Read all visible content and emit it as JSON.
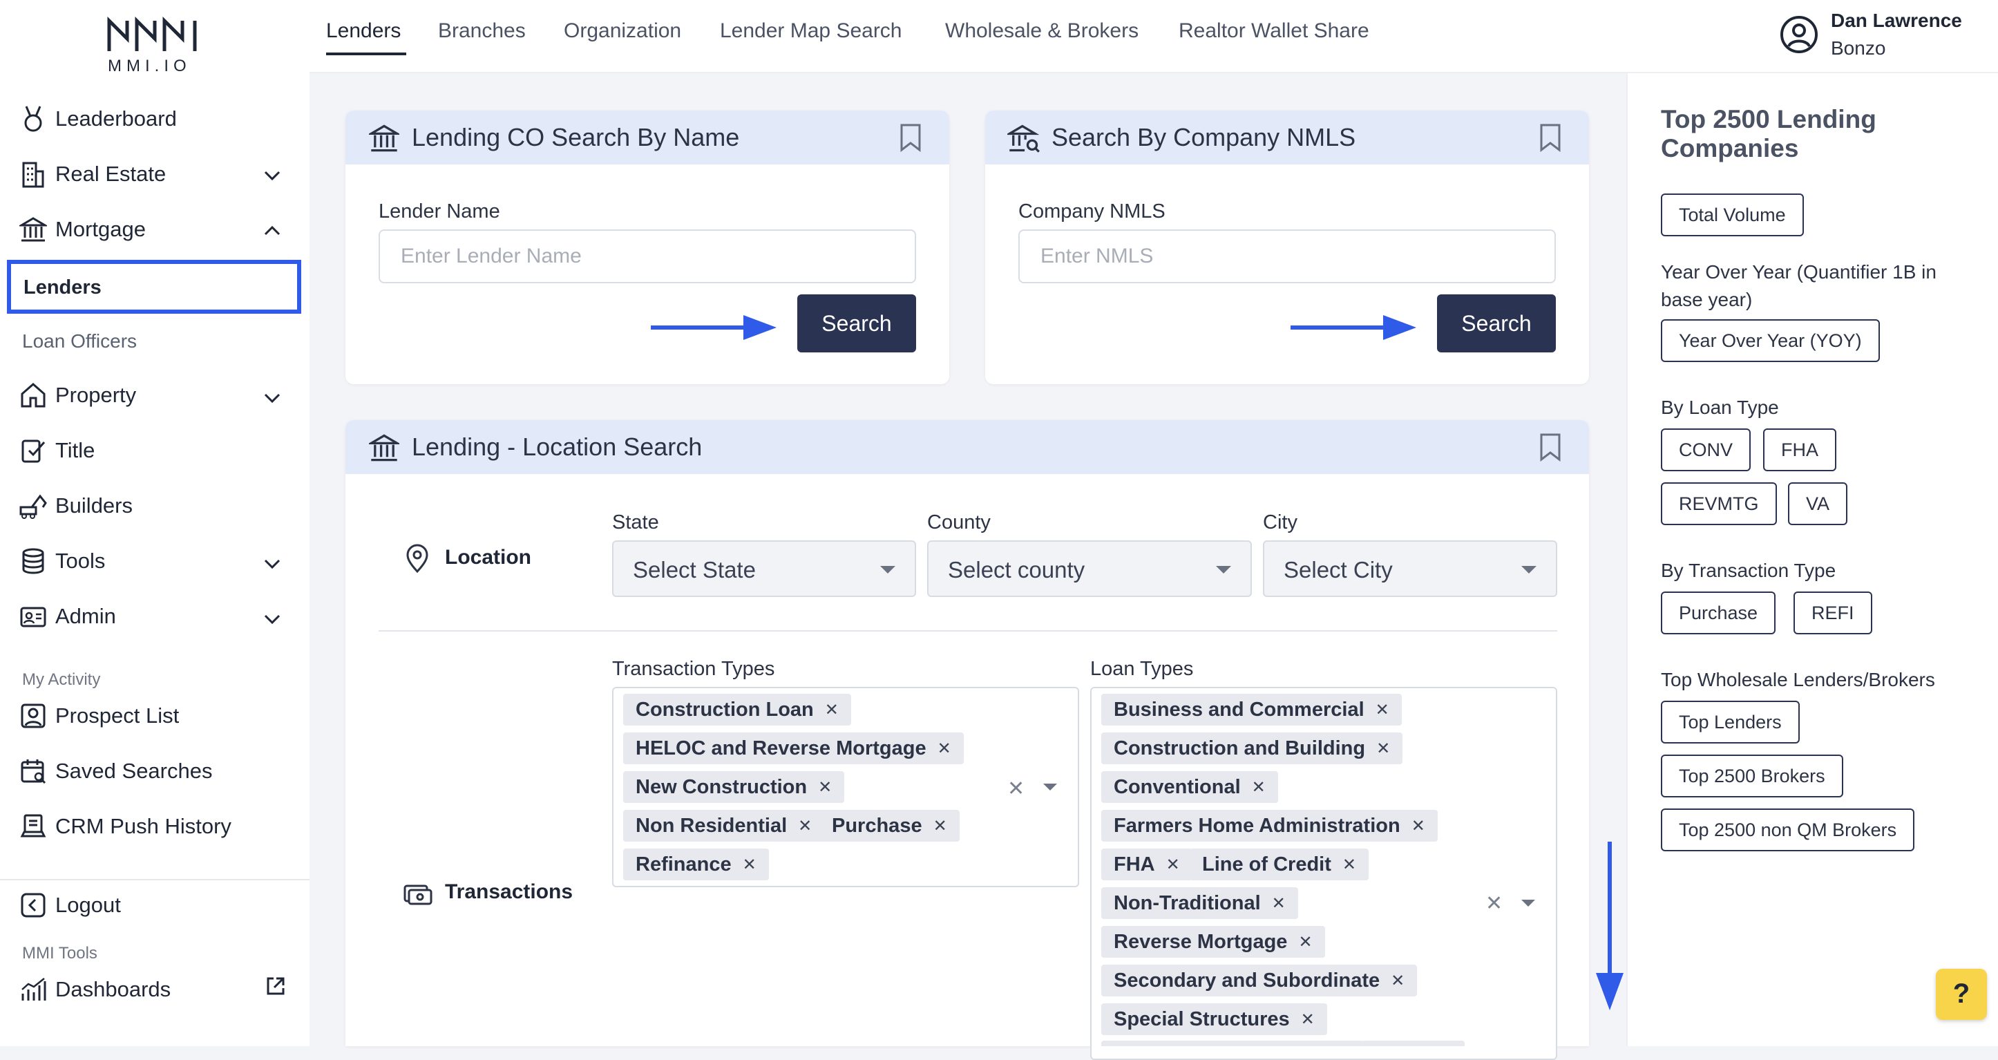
{
  "brand": {
    "logo_text": "MMI.IO"
  },
  "user": {
    "first": "Dan Lawrence",
    "last": "Bonzo"
  },
  "tabs": [
    "Lenders",
    "Branches",
    "Organization",
    "Lender Map Search",
    "Wholesale & Brokers",
    "Realtor Wallet Share"
  ],
  "sidebar": {
    "leaderboard": "Leaderboard",
    "real_estate": "Real Estate",
    "mortgage": "Mortgage",
    "lenders": "Lenders",
    "loan_officers": "Loan Officers",
    "property": "Property",
    "title": "Title",
    "builders": "Builders",
    "tools": "Tools",
    "admin": "Admin",
    "my_activity": "My Activity",
    "prospect_list": "Prospect List",
    "saved_searches": "Saved Searches",
    "crm_push": "CRM Push History",
    "logout": "Logout",
    "mmi_tools": "MMI Tools",
    "dashboards": "Dashboards"
  },
  "name_search": {
    "title": "Lending CO Search By Name",
    "label": "Lender Name",
    "placeholder": "Enter Lender Name",
    "button": "Search"
  },
  "nmls_search": {
    "title": "Search By Company NMLS",
    "label": "Company NMLS",
    "placeholder": "Enter NMLS",
    "button": "Search"
  },
  "location_search": {
    "title": "Lending - Location Search",
    "location_label": "Location",
    "state_label": "State",
    "state_value": "Select State",
    "county_label": "County",
    "county_value": "Select county",
    "city_label": "City",
    "city_value": "Select City",
    "transactions_label": "Transactions",
    "transaction_types_label": "Transaction Types",
    "transaction_types": [
      "Construction Loan",
      "HELOC and Reverse Mortgage",
      "New Construction",
      "Non Residential",
      "Purchase",
      "Refinance"
    ],
    "loan_types_label": "Loan Types",
    "loan_types": [
      "Business and Commercial",
      "Construction and Building",
      "Conventional",
      "Farmers Home Administration",
      "FHA",
      "Line of Credit",
      "Non-Traditional",
      "Reverse Mortgage",
      "Secondary and Subordinate",
      "Special Structures"
    ]
  },
  "right_panel": {
    "title": "Top 2500 Lending Companies",
    "total_volume": "Total Volume",
    "yoy_heading": "Year Over Year (Quantifier 1B in base year)",
    "yoy_button": "Year Over Year (YOY)",
    "loan_type_heading": "By Loan Type",
    "loan_type_buttons": [
      "CONV",
      "FHA",
      "REVMTG",
      "VA"
    ],
    "transaction_type_heading": "By Transaction Type",
    "transaction_type_buttons": [
      "Purchase",
      "REFI"
    ],
    "wholesale_heading": "Top Wholesale Lenders/Brokers",
    "wholesale_buttons": [
      "Top Lenders",
      "Top 2500 Brokers",
      "Top 2500 non QM Brokers"
    ]
  },
  "help_label": "?",
  "colors": {
    "accent": "#2b3352",
    "highlight": "#2f5be8",
    "card_header": "#e2eafa",
    "help": "#f7d44a",
    "arrow": "#2f5be8"
  }
}
